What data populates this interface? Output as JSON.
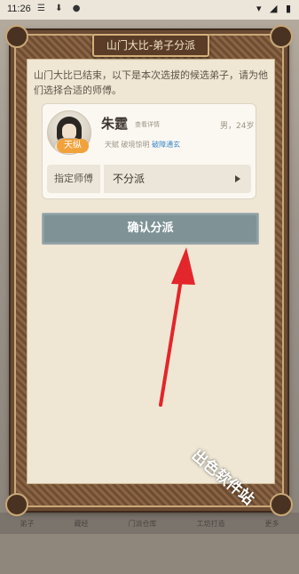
{
  "status_bar": {
    "time": "11:26",
    "left_icons": "☰ ⬇ ●",
    "right_icons": "▾ ◢ ▮"
  },
  "dialog": {
    "title": "山门大比-弟子分派",
    "intro": "山门大比已结束，以下是本次选拔的候选弟子，请为他们选择合适的师傅。"
  },
  "disciple": {
    "name": "朱霆",
    "detail_link": "查看详情",
    "gender_age": "男，24岁",
    "talent_badge": "天纵",
    "trait_prefix": "天赋",
    "trait_1": "破境惊明",
    "trait_2": "破障通玄",
    "avatar_icon": "avatar"
  },
  "assign": {
    "label": "指定师傅",
    "value": "不分派"
  },
  "confirm_button": "确认分派",
  "bottom_nav": [
    "弟子",
    "藏经",
    "门派仓库",
    "工坊打造",
    "更多"
  ],
  "watermark": "出色软件站",
  "colors": {
    "confirm_button_bg": "#7f9397",
    "talent_badge": "#f2a23b",
    "highlight_trait": "#3a87c8",
    "annotation_arrow": "#e3262b"
  }
}
